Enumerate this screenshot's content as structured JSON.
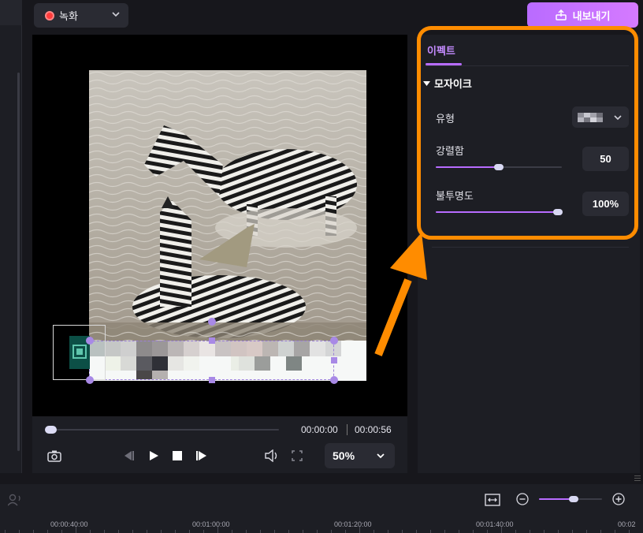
{
  "header": {
    "record_label": "녹화",
    "export_label": "내보내기"
  },
  "player": {
    "time_current": "00:00:00",
    "time_total": "00:00:56",
    "zoom_value": "50%",
    "progress": 0.0
  },
  "effects_panel": {
    "tab_label": "이펙트",
    "section_title": "모자이크",
    "type_label": "유형",
    "strength_label": "강렬함",
    "strength_value": "50",
    "strength_fraction": 0.5,
    "opacity_label": "불투명도",
    "opacity_value": "100%",
    "opacity_fraction": 1.0
  },
  "timeline": {
    "zoom_fraction": 0.55,
    "ticks": [
      "00:00:40:00",
      "00:01:00:00",
      "00:01:20:00",
      "00:01:40:00",
      "00:02"
    ]
  },
  "colors": {
    "accent": "#b86cff",
    "annotation": "#ff8c00",
    "record_dot": "#ff3b3b"
  }
}
